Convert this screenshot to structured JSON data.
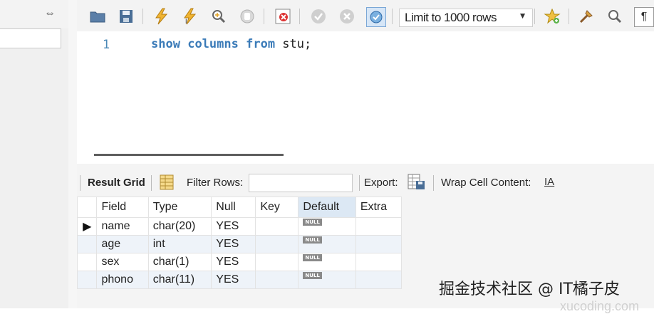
{
  "toolbar": {
    "limit_label": "Limit to 1000 rows",
    "icons": [
      "folder-icon",
      "save-icon",
      "execute-icon",
      "execute-current-icon",
      "explain-icon",
      "stop-icon",
      "toggle-error-icon",
      "commit-icon",
      "rollback-icon",
      "autocommit-icon",
      "add-snippet-icon",
      "beautify-icon",
      "find-icon",
      "invisible-chars-icon"
    ]
  },
  "editor": {
    "line_number": "1",
    "code_keyword_1": "show",
    "code_keyword_2": "columns",
    "code_keyword_3": "from",
    "code_rest": " stu;"
  },
  "result_toolbar": {
    "result_grid_label": "Result Grid",
    "filter_rows_label": "Filter Rows:",
    "export_label": "Export:",
    "wrap_label": "Wrap Cell Content:"
  },
  "grid": {
    "columns": [
      "Field",
      "Type",
      "Null",
      "Key",
      "Default",
      "Extra"
    ],
    "rows": [
      {
        "field": "name",
        "type": "char(20)",
        "null": "YES",
        "key": "",
        "default": "NULL",
        "extra": ""
      },
      {
        "field": "age",
        "type": "int",
        "null": "YES",
        "key": "",
        "default": "NULL",
        "extra": ""
      },
      {
        "field": "sex",
        "type": "char(1)",
        "null": "YES",
        "key": "",
        "default": "NULL",
        "extra": ""
      },
      {
        "field": "phono",
        "type": "char(11)",
        "null": "YES",
        "key": "",
        "default": "NULL",
        "extra": ""
      }
    ],
    "current_row_marker": "▶"
  },
  "watermark": {
    "main": "掘金技术社区 @ IT橘子皮",
    "sub": "xucoding.com"
  },
  "colors": {
    "keyword": "#3b7bb8",
    "selected_header": "#dce8f4",
    "alt_row": "#eef3f9"
  }
}
